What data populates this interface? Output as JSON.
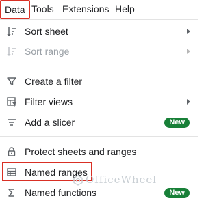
{
  "menubar": {
    "items": [
      {
        "label": "Data"
      },
      {
        "label": "Tools"
      },
      {
        "label": "Extensions"
      },
      {
        "label": "Help"
      }
    ]
  },
  "menu": {
    "items": [
      {
        "label": "Sort sheet",
        "icon": "sort-icon",
        "has_submenu": true,
        "disabled": false
      },
      {
        "label": "Sort range",
        "icon": "sort-icon",
        "has_submenu": true,
        "disabled": true
      },
      {
        "label": "Create a filter",
        "icon": "filter-icon",
        "has_submenu": false,
        "disabled": false
      },
      {
        "label": "Filter views",
        "icon": "filter-views-icon",
        "has_submenu": true,
        "disabled": false
      },
      {
        "label": "Add a slicer",
        "icon": "slicer-icon",
        "badge": "New",
        "disabled": false
      },
      {
        "label": "Protect sheets and ranges",
        "icon": "lock-icon",
        "has_submenu": false,
        "disabled": false
      },
      {
        "label": "Named ranges",
        "icon": "named-ranges-icon",
        "has_submenu": false,
        "disabled": false
      },
      {
        "label": "Named functions",
        "icon": "sigma-icon",
        "badge": "New",
        "disabled": false
      }
    ]
  },
  "watermark": {
    "text": "OfficeWheel"
  },
  "colors": {
    "highlight": "#d93025",
    "badge": "#188038",
    "text": "#202124",
    "disabled_text": "#9aa0a6",
    "icon": "#5f6368"
  }
}
